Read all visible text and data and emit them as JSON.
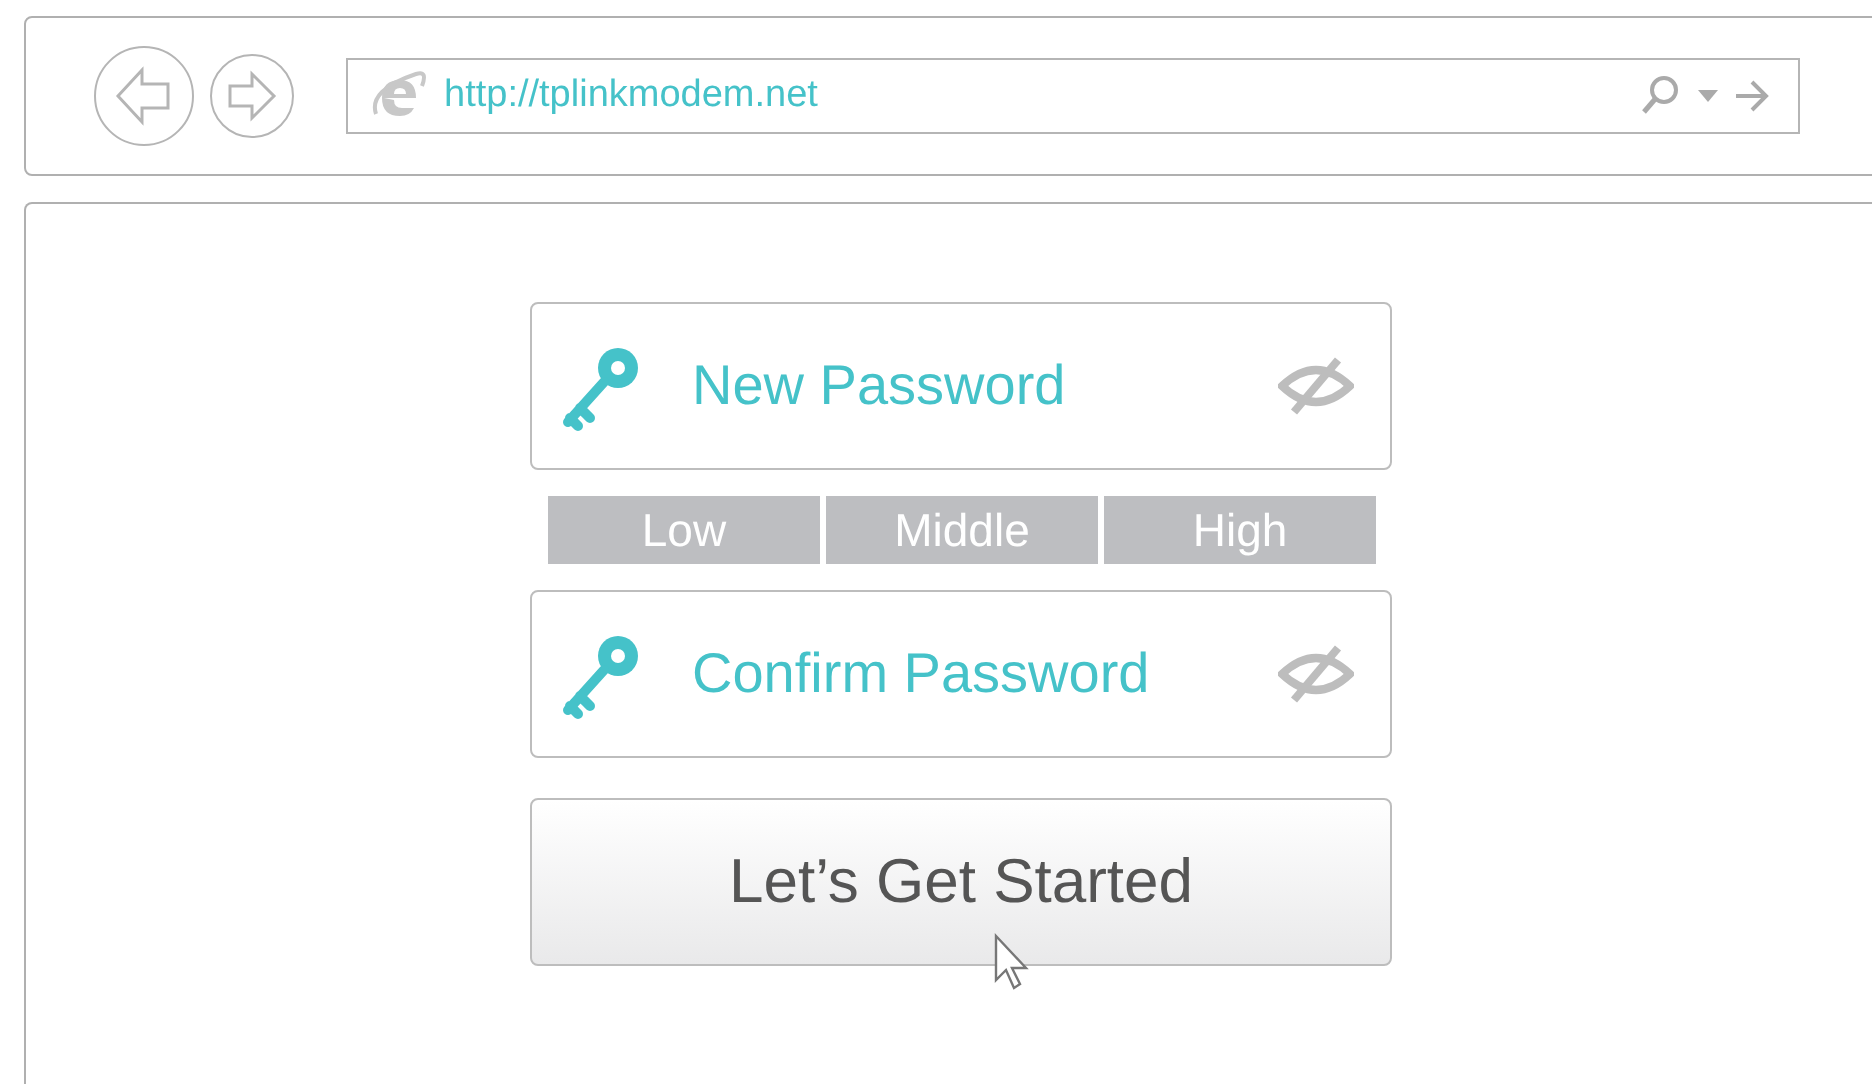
{
  "browser": {
    "address": "http://tplinkmodem.net"
  },
  "form": {
    "fields": [
      {
        "placeholder": "New Password"
      },
      {
        "placeholder": "Confirm Password"
      }
    ],
    "strength": [
      "Low",
      "Middle",
      "High"
    ],
    "button": "Let’s Get Started"
  }
}
